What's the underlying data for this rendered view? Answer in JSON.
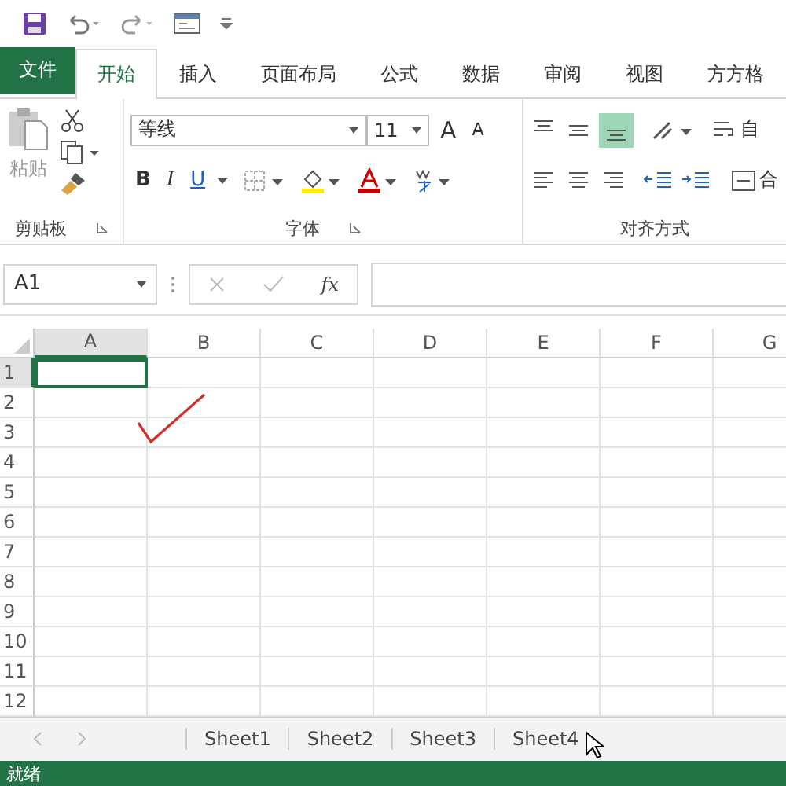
{
  "tabs": [
    {
      "label": "文件",
      "kind": "file",
      "selected": false
    },
    {
      "label": "开始",
      "kind": "tab",
      "selected": true
    },
    {
      "label": "插入",
      "kind": "tab",
      "selected": false
    },
    {
      "label": "页面布局",
      "kind": "tab",
      "selected": false
    },
    {
      "label": "公式",
      "kind": "tab",
      "selected": false
    },
    {
      "label": "数据",
      "kind": "tab",
      "selected": false
    },
    {
      "label": "审阅",
      "kind": "tab",
      "selected": false
    },
    {
      "label": "视图",
      "kind": "tab",
      "selected": false
    },
    {
      "label": "方方格",
      "kind": "tab",
      "selected": false
    }
  ],
  "clipboard": {
    "paste": "粘贴",
    "label": "剪贴板"
  },
  "font": {
    "font_name": "等线",
    "font_size": "11",
    "grow": "A",
    "shrink": "A",
    "bold": "B",
    "italic": "I",
    "underline": "U",
    "label": "字体"
  },
  "alignment": {
    "wrap": "自",
    "merge": "合",
    "label": "对齐方式"
  },
  "formula_bar": {
    "name_box": "A1",
    "fx": "fx"
  },
  "sheet": {
    "columns": [
      {
        "label": "A",
        "selected": true
      },
      {
        "label": "B",
        "selected": false
      },
      {
        "label": "C",
        "selected": false
      },
      {
        "label": "D",
        "selected": false
      },
      {
        "label": "E",
        "selected": false
      },
      {
        "label": "F",
        "selected": false
      },
      {
        "label": "G",
        "selected": false
      }
    ],
    "rows": [
      {
        "label": "1",
        "selected": true
      },
      {
        "label": "2",
        "selected": false
      },
      {
        "label": "3",
        "selected": false
      },
      {
        "label": "4",
        "selected": false
      },
      {
        "label": "5",
        "selected": false
      },
      {
        "label": "6",
        "selected": false
      },
      {
        "label": "7",
        "selected": false
      },
      {
        "label": "8",
        "selected": false
      },
      {
        "label": "9",
        "selected": false
      },
      {
        "label": "10",
        "selected": false
      },
      {
        "label": "11",
        "selected": false
      },
      {
        "label": "12",
        "selected": false
      }
    ]
  },
  "sheet_tabs": [
    {
      "label": "Sheet1"
    },
    {
      "label": "Sheet2"
    },
    {
      "label": "Sheet3"
    },
    {
      "label": "Sheet4"
    }
  ],
  "status_bar": {
    "text": "就绪"
  }
}
